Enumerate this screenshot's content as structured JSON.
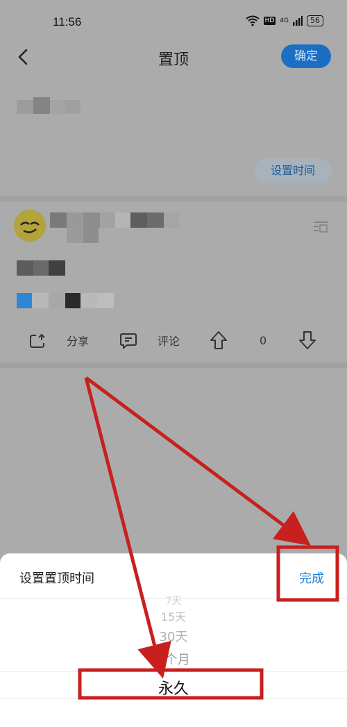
{
  "status_bar": {
    "time": "11:56",
    "wifi_icon": "wifi-icon",
    "hd": "HD",
    "signal": "4G",
    "battery": "56"
  },
  "header": {
    "title": "置顶",
    "confirm_label": "确定"
  },
  "top_block": {
    "set_time_label": "设置时间"
  },
  "post": {
    "actions": {
      "share_label": "分享",
      "comment_label": "评论",
      "vote_count": "0"
    }
  },
  "sheet": {
    "title": "设置置顶时间",
    "done_label": "完成",
    "options": [
      "7天",
      "15天",
      "30天",
      "6个月",
      "永久"
    ],
    "selected": "永久"
  },
  "colors": {
    "accent": "#1a7ddc",
    "confirm_bg": "#1a6fc4",
    "overlay": "#ababab",
    "annotation": "#c8201e"
  }
}
